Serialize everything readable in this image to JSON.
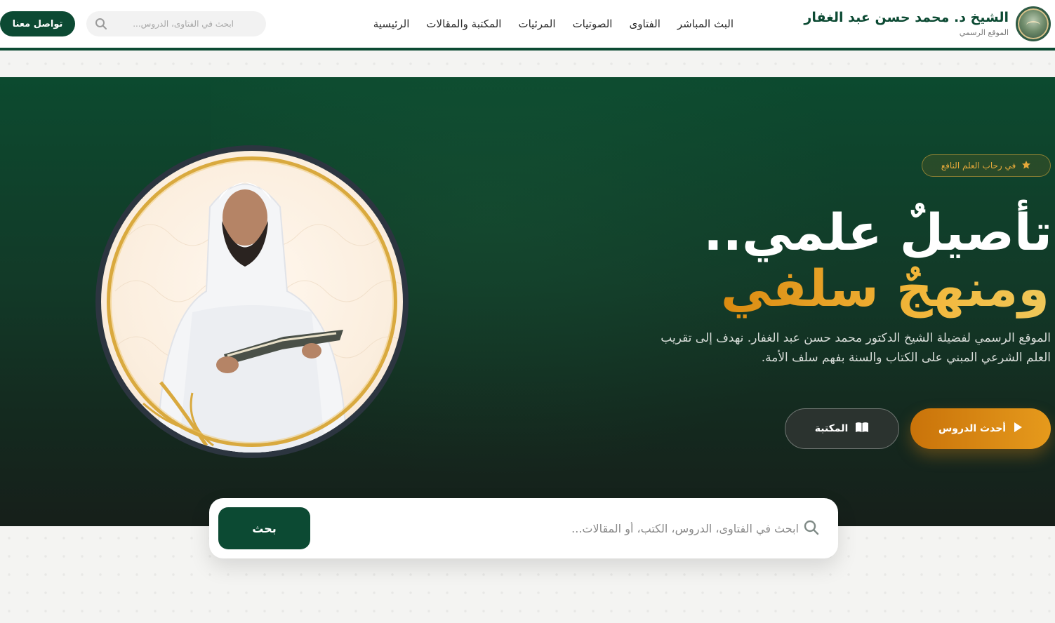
{
  "header": {
    "site_title": "الشيخ د. محمد حسن عبد الغفار",
    "site_subtitle": "الموقع الرسمي",
    "nav": [
      {
        "label": "الرئيسية"
      },
      {
        "label": "المكتبة والمقالات"
      },
      {
        "label": "المرئيات"
      },
      {
        "label": "الصوتيات"
      },
      {
        "label": "الفتاوى"
      },
      {
        "label": "البث المباشر"
      }
    ],
    "search_placeholder": "ابحث في الفتاوى، الدروس...",
    "contact_label": "تواصل معنا"
  },
  "hero": {
    "badge": "في رحاب العلم النافع",
    "headline_line1": "تأصيلٌ علمي..",
    "headline_line2": "ومنهجٌ سلفي",
    "description": "الموقع الرسمي لفضيلة الشيخ الدكتور محمد حسن عبد الغفار. نهدف إلى تقريب العلم الشرعي المبني على الكتاب والسنة بفهم سلف الأمة.",
    "primary_button": "أحدث الدروس",
    "secondary_button": "المكتبة"
  },
  "search": {
    "placeholder": "ابحث في الفتاوى، الدروس، الكتب، أو المقالات...",
    "button_label": "بحث"
  },
  "colors": {
    "brand_green": "#0c4a33",
    "accent_gold": "#e69a1c"
  },
  "icons": {
    "search": "search-icon",
    "star": "star-icon",
    "play": "play-icon",
    "book": "book-icon"
  }
}
